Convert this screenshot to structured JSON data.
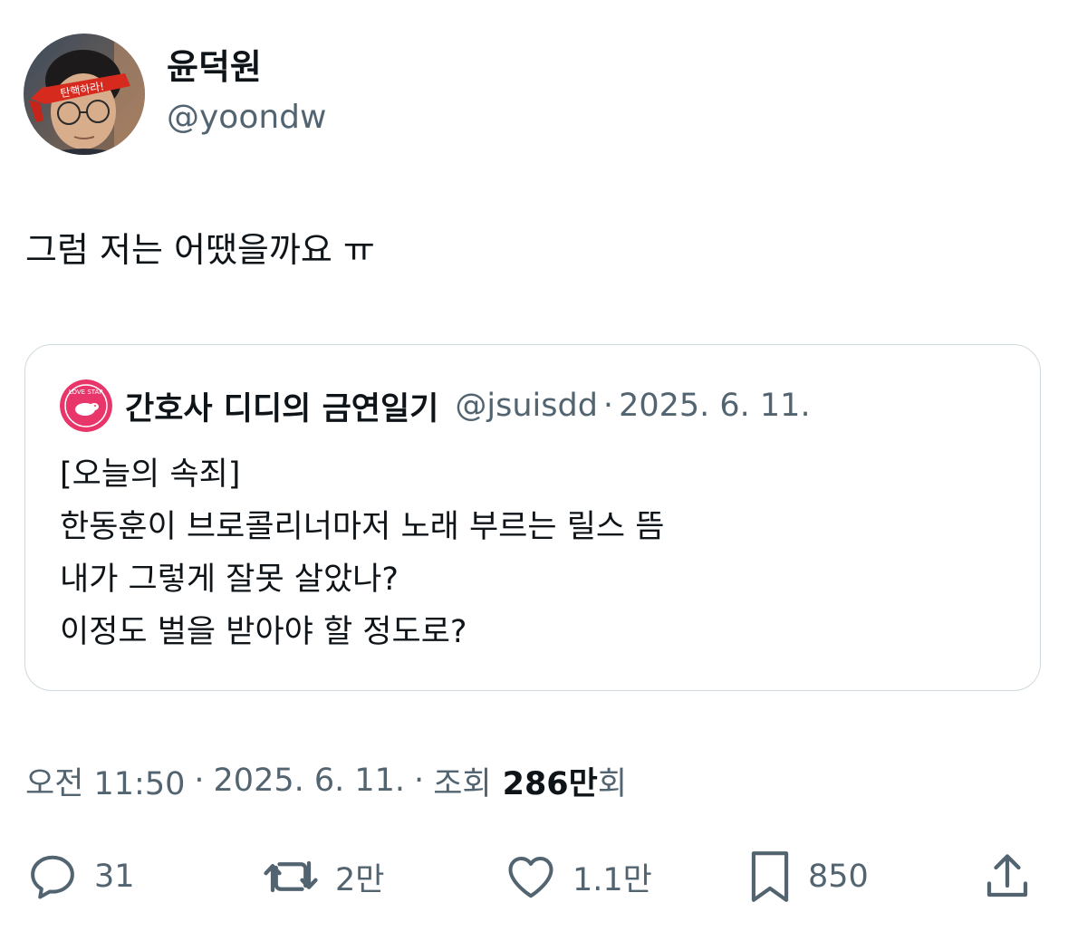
{
  "author": {
    "display_name": "윤덕원",
    "handle": "@yoondw",
    "avatar_headband_text": "탄핵하라!"
  },
  "tweet": {
    "text": "그럼 저는 어땠을까요 ㅠ"
  },
  "quote": {
    "display_name": "간호사 디디의 금연일기",
    "handle": "@jsuisdd",
    "date": "2025. 6. 11.",
    "avatar_badge_text": "LOVE STAR",
    "lines": [
      "[오늘의 속죄]",
      "한동훈이 브로콜리너마저 노래 부르는 릴스 뜸",
      "내가 그렇게 잘못 살았나?",
      "이정도 벌을 받아야 할 정도로?"
    ]
  },
  "meta": {
    "time": "오전 11:50",
    "date": "2025. 6. 11.",
    "views_label": "조회",
    "views_count": "286만",
    "views_suffix": "회"
  },
  "actions": {
    "reply": {
      "icon": "reply-icon",
      "count": "31"
    },
    "retweet": {
      "icon": "retweet-icon",
      "count": "2만"
    },
    "like": {
      "icon": "heart-icon",
      "count": "1.1만"
    },
    "bookmark": {
      "icon": "bookmark-icon",
      "count": "850"
    },
    "share": {
      "icon": "share-icon"
    }
  },
  "colors": {
    "text": "#0f1419",
    "secondary": "#536471",
    "border": "#cfd9de"
  }
}
